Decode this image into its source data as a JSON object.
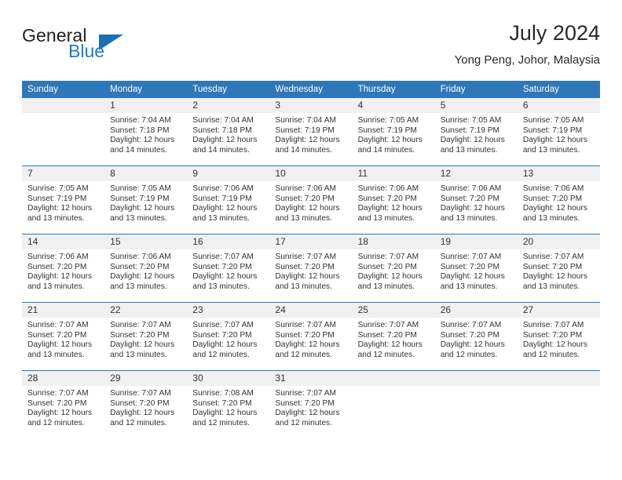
{
  "brand": {
    "word1": "General",
    "word2": "Blue",
    "triangle_color": "#1b6fb3",
    "blue_color": "#1f7ac1"
  },
  "header": {
    "title": "July 2024",
    "subtitle": "Yong Peng, Johor, Malaysia"
  },
  "theme": {
    "header_bg": "#2e77b8",
    "daynum_bg": "#f0f0f0",
    "rule_color": "#2e77b8"
  },
  "weekday_headers": [
    "Sunday",
    "Monday",
    "Tuesday",
    "Wednesday",
    "Thursday",
    "Friday",
    "Saturday"
  ],
  "labels": {
    "sunrise_prefix": "Sunrise:",
    "sunset_prefix": "Sunset:",
    "daylight_prefix": "Daylight:"
  },
  "weeks": [
    [
      {
        "day": "",
        "line1": "",
        "line2": "",
        "line3": "",
        "line4": ""
      },
      {
        "day": "1",
        "line1": "Sunrise: 7:04 AM",
        "line2": "Sunset: 7:18 PM",
        "line3": "Daylight: 12 hours",
        "line4": "and 14 minutes."
      },
      {
        "day": "2",
        "line1": "Sunrise: 7:04 AM",
        "line2": "Sunset: 7:18 PM",
        "line3": "Daylight: 12 hours",
        "line4": "and 14 minutes."
      },
      {
        "day": "3",
        "line1": "Sunrise: 7:04 AM",
        "line2": "Sunset: 7:19 PM",
        "line3": "Daylight: 12 hours",
        "line4": "and 14 minutes."
      },
      {
        "day": "4",
        "line1": "Sunrise: 7:05 AM",
        "line2": "Sunset: 7:19 PM",
        "line3": "Daylight: 12 hours",
        "line4": "and 14 minutes."
      },
      {
        "day": "5",
        "line1": "Sunrise: 7:05 AM",
        "line2": "Sunset: 7:19 PM",
        "line3": "Daylight: 12 hours",
        "line4": "and 13 minutes."
      },
      {
        "day": "6",
        "line1": "Sunrise: 7:05 AM",
        "line2": "Sunset: 7:19 PM",
        "line3": "Daylight: 12 hours",
        "line4": "and 13 minutes."
      }
    ],
    [
      {
        "day": "7",
        "line1": "Sunrise: 7:05 AM",
        "line2": "Sunset: 7:19 PM",
        "line3": "Daylight: 12 hours",
        "line4": "and 13 minutes."
      },
      {
        "day": "8",
        "line1": "Sunrise: 7:05 AM",
        "line2": "Sunset: 7:19 PM",
        "line3": "Daylight: 12 hours",
        "line4": "and 13 minutes."
      },
      {
        "day": "9",
        "line1": "Sunrise: 7:06 AM",
        "line2": "Sunset: 7:19 PM",
        "line3": "Daylight: 12 hours",
        "line4": "and 13 minutes."
      },
      {
        "day": "10",
        "line1": "Sunrise: 7:06 AM",
        "line2": "Sunset: 7:20 PM",
        "line3": "Daylight: 12 hours",
        "line4": "and 13 minutes."
      },
      {
        "day": "11",
        "line1": "Sunrise: 7:06 AM",
        "line2": "Sunset: 7:20 PM",
        "line3": "Daylight: 12 hours",
        "line4": "and 13 minutes."
      },
      {
        "day": "12",
        "line1": "Sunrise: 7:06 AM",
        "line2": "Sunset: 7:20 PM",
        "line3": "Daylight: 12 hours",
        "line4": "and 13 minutes."
      },
      {
        "day": "13",
        "line1": "Sunrise: 7:06 AM",
        "line2": "Sunset: 7:20 PM",
        "line3": "Daylight: 12 hours",
        "line4": "and 13 minutes."
      }
    ],
    [
      {
        "day": "14",
        "line1": "Sunrise: 7:06 AM",
        "line2": "Sunset: 7:20 PM",
        "line3": "Daylight: 12 hours",
        "line4": "and 13 minutes."
      },
      {
        "day": "15",
        "line1": "Sunrise: 7:06 AM",
        "line2": "Sunset: 7:20 PM",
        "line3": "Daylight: 12 hours",
        "line4": "and 13 minutes."
      },
      {
        "day": "16",
        "line1": "Sunrise: 7:07 AM",
        "line2": "Sunset: 7:20 PM",
        "line3": "Daylight: 12 hours",
        "line4": "and 13 minutes."
      },
      {
        "day": "17",
        "line1": "Sunrise: 7:07 AM",
        "line2": "Sunset: 7:20 PM",
        "line3": "Daylight: 12 hours",
        "line4": "and 13 minutes."
      },
      {
        "day": "18",
        "line1": "Sunrise: 7:07 AM",
        "line2": "Sunset: 7:20 PM",
        "line3": "Daylight: 12 hours",
        "line4": "and 13 minutes."
      },
      {
        "day": "19",
        "line1": "Sunrise: 7:07 AM",
        "line2": "Sunset: 7:20 PM",
        "line3": "Daylight: 12 hours",
        "line4": "and 13 minutes."
      },
      {
        "day": "20",
        "line1": "Sunrise: 7:07 AM",
        "line2": "Sunset: 7:20 PM",
        "line3": "Daylight: 12 hours",
        "line4": "and 13 minutes."
      }
    ],
    [
      {
        "day": "21",
        "line1": "Sunrise: 7:07 AM",
        "line2": "Sunset: 7:20 PM",
        "line3": "Daylight: 12 hours",
        "line4": "and 13 minutes."
      },
      {
        "day": "22",
        "line1": "Sunrise: 7:07 AM",
        "line2": "Sunset: 7:20 PM",
        "line3": "Daylight: 12 hours",
        "line4": "and 13 minutes."
      },
      {
        "day": "23",
        "line1": "Sunrise: 7:07 AM",
        "line2": "Sunset: 7:20 PM",
        "line3": "Daylight: 12 hours",
        "line4": "and 12 minutes."
      },
      {
        "day": "24",
        "line1": "Sunrise: 7:07 AM",
        "line2": "Sunset: 7:20 PM",
        "line3": "Daylight: 12 hours",
        "line4": "and 12 minutes."
      },
      {
        "day": "25",
        "line1": "Sunrise: 7:07 AM",
        "line2": "Sunset: 7:20 PM",
        "line3": "Daylight: 12 hours",
        "line4": "and 12 minutes."
      },
      {
        "day": "26",
        "line1": "Sunrise: 7:07 AM",
        "line2": "Sunset: 7:20 PM",
        "line3": "Daylight: 12 hours",
        "line4": "and 12 minutes."
      },
      {
        "day": "27",
        "line1": "Sunrise: 7:07 AM",
        "line2": "Sunset: 7:20 PM",
        "line3": "Daylight: 12 hours",
        "line4": "and 12 minutes."
      }
    ],
    [
      {
        "day": "28",
        "line1": "Sunrise: 7:07 AM",
        "line2": "Sunset: 7:20 PM",
        "line3": "Daylight: 12 hours",
        "line4": "and 12 minutes."
      },
      {
        "day": "29",
        "line1": "Sunrise: 7:07 AM",
        "line2": "Sunset: 7:20 PM",
        "line3": "Daylight: 12 hours",
        "line4": "and 12 minutes."
      },
      {
        "day": "30",
        "line1": "Sunrise: 7:08 AM",
        "line2": "Sunset: 7:20 PM",
        "line3": "Daylight: 12 hours",
        "line4": "and 12 minutes."
      },
      {
        "day": "31",
        "line1": "Sunrise: 7:07 AM",
        "line2": "Sunset: 7:20 PM",
        "line3": "Daylight: 12 hours",
        "line4": "and 12 minutes."
      },
      {
        "day": "",
        "line1": "",
        "line2": "",
        "line3": "",
        "line4": ""
      },
      {
        "day": "",
        "line1": "",
        "line2": "",
        "line3": "",
        "line4": ""
      },
      {
        "day": "",
        "line1": "",
        "line2": "",
        "line3": "",
        "line4": ""
      }
    ]
  ]
}
